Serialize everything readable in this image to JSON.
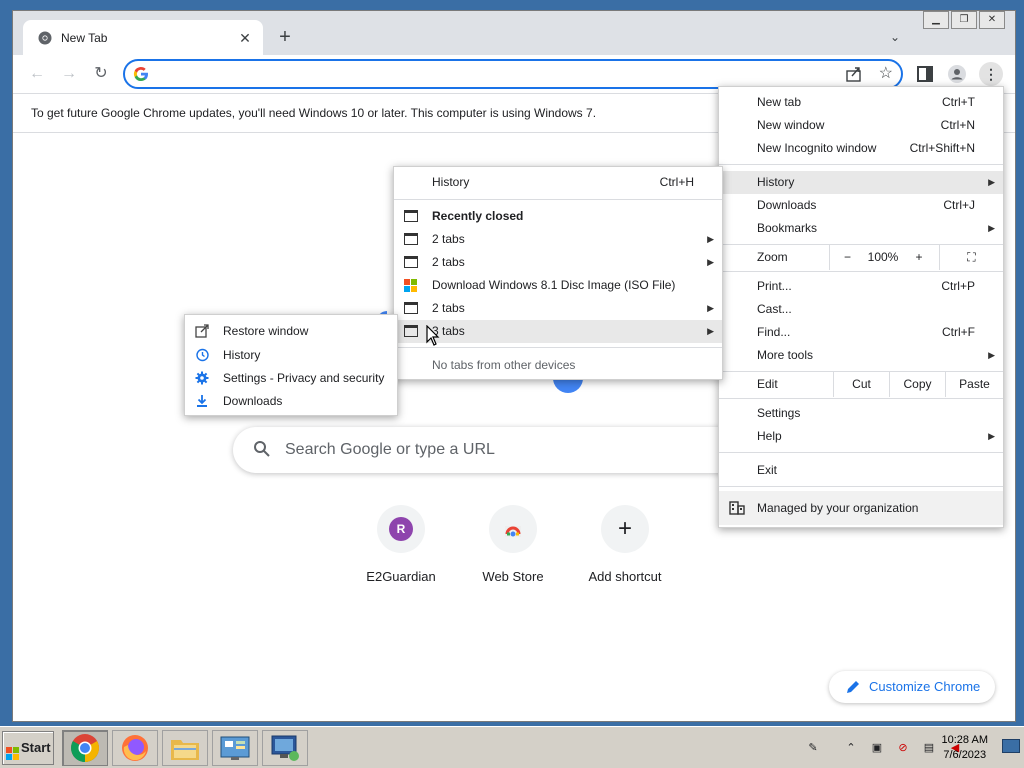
{
  "browser": {
    "tab_title": "New Tab",
    "infobar_text": "To get future Google Chrome updates, you'll need Windows 10 or later. This computer is using Windows 7."
  },
  "ntp": {
    "search_placeholder": "Search Google or type a URL",
    "shortcuts": [
      {
        "label": "E2Guardian",
        "badge": "R"
      },
      {
        "label": "Web Store"
      },
      {
        "label": "Add shortcut"
      }
    ],
    "customize_label": "Customize Chrome"
  },
  "main_menu": {
    "new_tab": "New tab",
    "new_tab_sc": "Ctrl+T",
    "new_window": "New window",
    "new_window_sc": "Ctrl+N",
    "new_incognito": "New Incognito window",
    "new_incognito_sc": "Ctrl+Shift+N",
    "history": "History",
    "downloads": "Downloads",
    "downloads_sc": "Ctrl+J",
    "bookmarks": "Bookmarks",
    "zoom": "Zoom",
    "zoom_minus": "−",
    "zoom_value": "100%",
    "zoom_plus": "+",
    "print": "Print...",
    "print_sc": "Ctrl+P",
    "cast": "Cast...",
    "find": "Find...",
    "find_sc": "Ctrl+F",
    "more_tools": "More tools",
    "edit": "Edit",
    "cut": "Cut",
    "copy": "Copy",
    "paste": "Paste",
    "settings": "Settings",
    "help": "Help",
    "exit": "Exit",
    "managed": "Managed by your organization"
  },
  "history_menu": {
    "history": "History",
    "history_sc": "Ctrl+H",
    "recently_closed": "Recently closed",
    "items": [
      "2 tabs",
      "2 tabs",
      "Download Windows 8.1 Disc Image (ISO File)",
      "2 tabs",
      "3 tabs"
    ],
    "no_tabs": "No tabs from other devices"
  },
  "context_menu": {
    "items": [
      "Restore window",
      "History",
      "Settings - Privacy and security",
      "Downloads"
    ]
  },
  "taskbar": {
    "start": "Start",
    "time": "10:28 AM",
    "date": "7/6/2023"
  }
}
